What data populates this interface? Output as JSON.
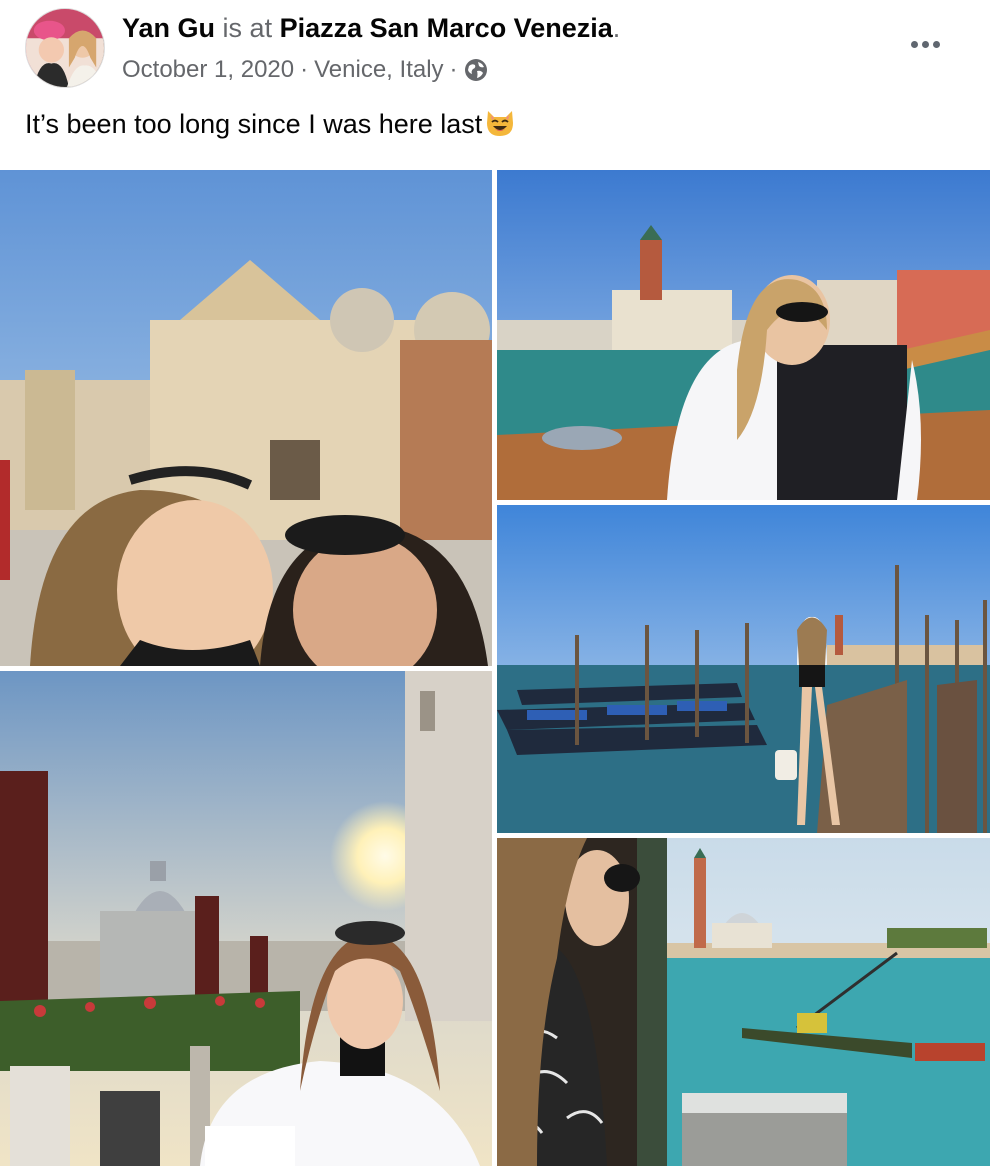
{
  "post": {
    "author": "Yan Gu",
    "is_at": "is at",
    "place": "Piazza San Marco Venezia",
    "period": ".",
    "date": "October 1, 2020",
    "separator": "·",
    "location": "Venice, Italy",
    "separator2": "·",
    "privacy_icon": "globe-icon",
    "more_icon": "more-options-icon",
    "text": "It’s been too long since I was here last",
    "emoji": "smiling-cat-emoji"
  },
  "photos": [
    {
      "name": "photo-st-marks-basilica-selfie"
    },
    {
      "name": "photo-boat-doges-palace"
    },
    {
      "name": "photo-gondolas-pier"
    },
    {
      "name": "photo-santa-maria-della-salute-sunset"
    },
    {
      "name": "photo-san-giorgio-maggiore-view"
    }
  ],
  "colors": {
    "text_primary": "#050505",
    "text_secondary": "#65676b",
    "background": "#ffffff"
  }
}
